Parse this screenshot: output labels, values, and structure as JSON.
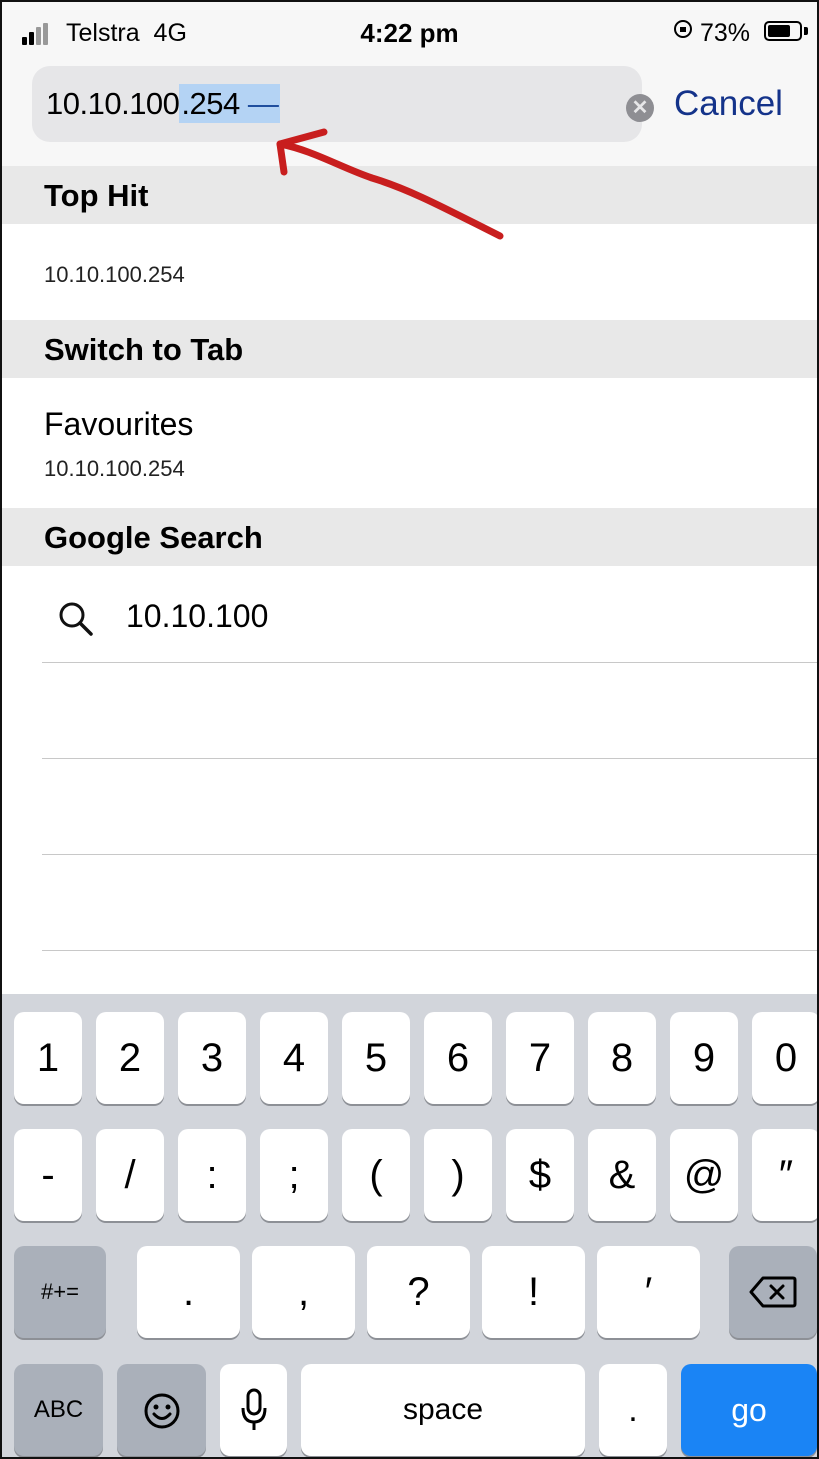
{
  "status_bar": {
    "carrier": "Telstra",
    "network": "4G",
    "time": "4:22 pm",
    "battery_percent": "73%",
    "battery_level": 0.73,
    "icons": [
      "signal-icon",
      "rotation-lock-icon",
      "battery-icon"
    ]
  },
  "address_bar": {
    "typed": "10.10.100",
    "autocomplete": ".254",
    "trailing": " —",
    "clear_icon": "✕",
    "cancel_label": "Cancel"
  },
  "annotation": {
    "color": "#c81e1e",
    "icon": "red-arrow-annotation"
  },
  "sections": {
    "top_hit": {
      "title": "Top Hit",
      "url": "10.10.100.254"
    },
    "switch_to_tab": {
      "title": "Switch to Tab",
      "tab_title": "Favourites",
      "url": "10.10.100.254"
    },
    "google_search": {
      "title": "Google Search",
      "query": "10.10.100"
    }
  },
  "keyboard": {
    "row1": [
      "1",
      "2",
      "3",
      "4",
      "5",
      "6",
      "7",
      "8",
      "9",
      "0"
    ],
    "row2": [
      "-",
      "/",
      ":",
      ";",
      "(",
      ")",
      "$",
      "&",
      "@",
      "″"
    ],
    "row3": {
      "mode": "#+=",
      "keys": [
        ".",
        ",",
        "?",
        "!",
        "′"
      ],
      "delete_icon": "delete-icon"
    },
    "row4": {
      "abc": "ABC",
      "emoji_icon": "emoji-icon",
      "mic_icon": "mic-icon",
      "space": "space",
      "dot": ".",
      "go": "go"
    },
    "go_color": "#1a84f5"
  }
}
